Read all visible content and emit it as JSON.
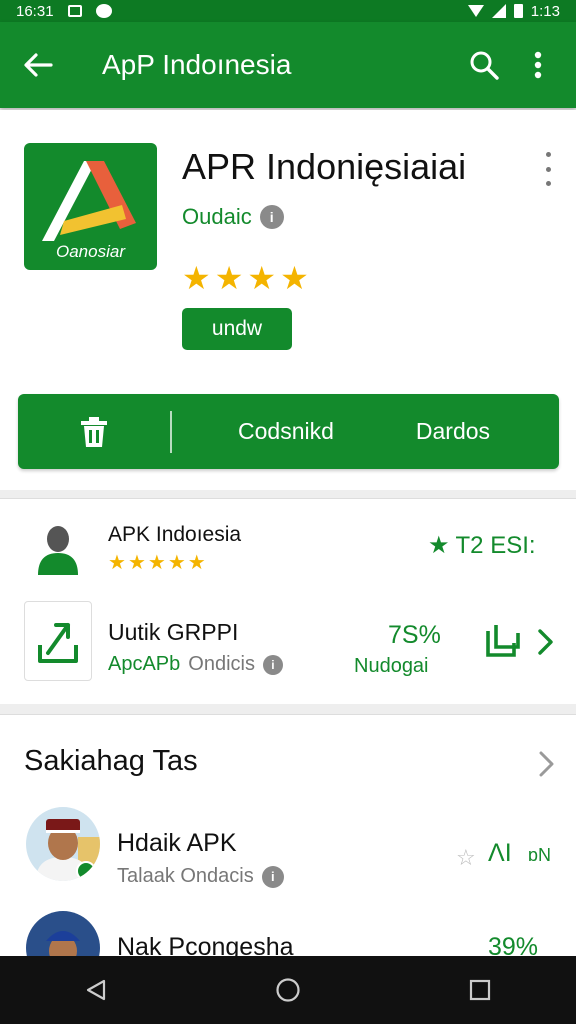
{
  "status_bar": {
    "time": "16:31",
    "clock_right": "1:13"
  },
  "toolbar": {
    "title": "ApP Indoınesia"
  },
  "app": {
    "icon_text": "Oanosiar",
    "name": "APR Indonięsiaiai",
    "developer": "Oudaic",
    "rating_stars": 4,
    "tag_label": "undw",
    "actions": {
      "action1": "Codsnikd",
      "action2": "Dardos"
    }
  },
  "list": {
    "row1": {
      "name": "APK Indoıesia",
      "stars": 5,
      "score": "T2 ESI:"
    },
    "row2": {
      "name": "Uutik GRPPI",
      "developer": "ApcAPb",
      "dev_sub": "Ondicis",
      "percent": "7S%",
      "percent_label": "Nudogai"
    }
  },
  "section": {
    "title": "Sakiahag Tas",
    "people": [
      {
        "name": "Hdaik APK",
        "sub": "Talaak Ondacis",
        "value": "ɅI",
        "value2": "ɒN"
      },
      {
        "name": "Nak Pcongesha",
        "value": "39%"
      }
    ]
  },
  "icons": {
    "back": "arrow-left-icon",
    "search": "search-icon",
    "more": "more-vertical-icon",
    "trash": "trash-icon",
    "info": "info-icon",
    "star": "star-icon",
    "chevron": "chevron-right-icon",
    "doc": "document-icon",
    "nav_back": "nav-back-icon",
    "nav_home": "nav-home-icon",
    "nav_recent": "nav-recent-icon"
  },
  "colors": {
    "primary": "#138a2c",
    "status_bar": "#0d7a23",
    "star": "#f4b400",
    "nav": "#111111"
  }
}
